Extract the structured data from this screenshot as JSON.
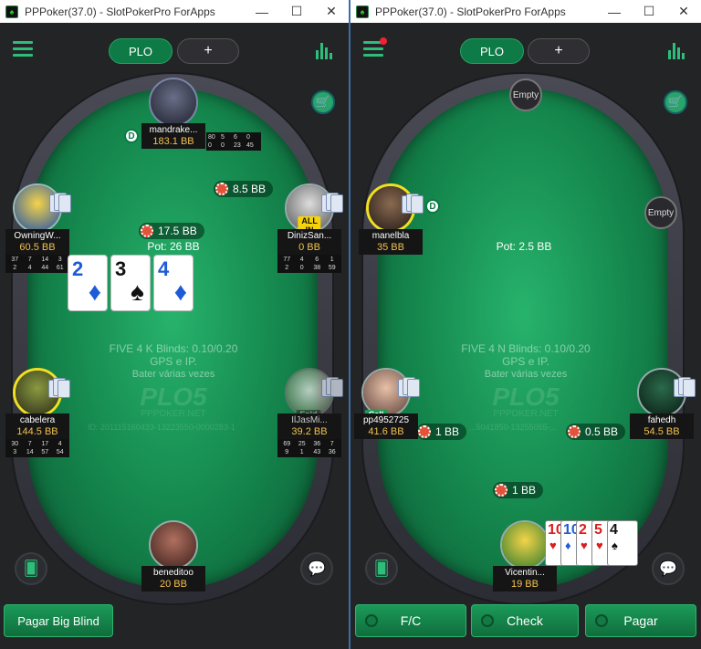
{
  "windows": [
    {
      "title": "PPPoker(37.0) - SlotPokerPro ForApps",
      "mode_pill": "PLO",
      "add_pill": "+",
      "board": [
        {
          "rank": "2",
          "suit": "♦",
          "color": "blue"
        },
        {
          "rank": "3",
          "suit": "♠",
          "color": "black"
        },
        {
          "rank": "4",
          "suit": "♦",
          "color": "blue"
        }
      ],
      "side_pot": "17.5 BB",
      "pot": "Pot: 26 BB",
      "game_info": "FIVE 4 K   Blinds: 0.10/0.20",
      "gps": "GPS e IP.",
      "rebuy": "Bater várias vezes",
      "watermark": "PLO5",
      "watermark_sub": "PPPOKER.NET",
      "game_id": "ID: 201115160433-13223550-0000283-1",
      "seats": [
        {
          "name": "mandrake...",
          "stack": "183.1 BB",
          "stats": [
            "80",
            "5",
            "6",
            "0",
            "0",
            "0",
            "23",
            "45"
          ]
        },
        {
          "name": "OwningW...",
          "stack": "60.5 BB",
          "stats": [
            "37",
            "7",
            "14",
            "3",
            "2",
            "4",
            "44",
            "61"
          ]
        },
        {
          "name": "DinizSan...",
          "stack": "0 BB",
          "tag": "ALL IN",
          "stats": [
            "77",
            "4",
            "6",
            "1",
            "2",
            "0",
            "38",
            "59"
          ]
        },
        {
          "name": "cabelera",
          "stack": "144.5 BB",
          "stats": [
            "30",
            "7",
            "17",
            "4",
            "3",
            "14",
            "57",
            "54"
          ]
        },
        {
          "name": "IlJasMi...",
          "stack": "39.2 BB",
          "tag": "Fold",
          "stats": [
            "69",
            "25",
            "36",
            "7",
            "9",
            "1",
            "43",
            "36"
          ]
        },
        {
          "name": "beneditoo",
          "stack": "20 BB"
        }
      ],
      "bets": [
        "8.5 BB"
      ],
      "dealer_label": "D",
      "action_button": "Pagar Big Blind"
    },
    {
      "title": "PPPoker(37.0) - SlotPokerPro ForApps",
      "mode_pill": "PLO",
      "add_pill": "+",
      "pot": "Pot: 2.5 BB",
      "game_info": "FIVE 4 N   Blinds: 0.10/0.20",
      "gps": "GPS e IP.",
      "rebuy": "Bater várias vezes",
      "watermark": "PLO5",
      "watermark_sub": "PPPOKER.NET",
      "game_id": "...5041850-13255055-...",
      "empty_label": "Empty",
      "seats": [
        {
          "name": "manelbla",
          "stack": "35 BB"
        },
        {
          "name": "pp4952725",
          "stack": "41.6 BB",
          "tag": "Call"
        },
        {
          "name": "fahedh",
          "stack": "54.5 BB"
        },
        {
          "name": "Vicentin...",
          "stack": "19 BB"
        }
      ],
      "bets": [
        "1 BB",
        "0.5 BB",
        "1 BB"
      ],
      "dealer_label": "D",
      "hand": [
        {
          "rank": "10",
          "suit": "♥",
          "color": "red"
        },
        {
          "rank": "10",
          "suit": "♦",
          "color": "blue"
        },
        {
          "rank": "2",
          "suit": "♥",
          "color": "red"
        },
        {
          "rank": "5",
          "suit": "♥",
          "color": "red"
        },
        {
          "rank": "4",
          "suit": "♠",
          "color": "black"
        }
      ],
      "buttons": {
        "fold_check": "F/C",
        "check": "Check",
        "call": "Pagar"
      }
    }
  ]
}
